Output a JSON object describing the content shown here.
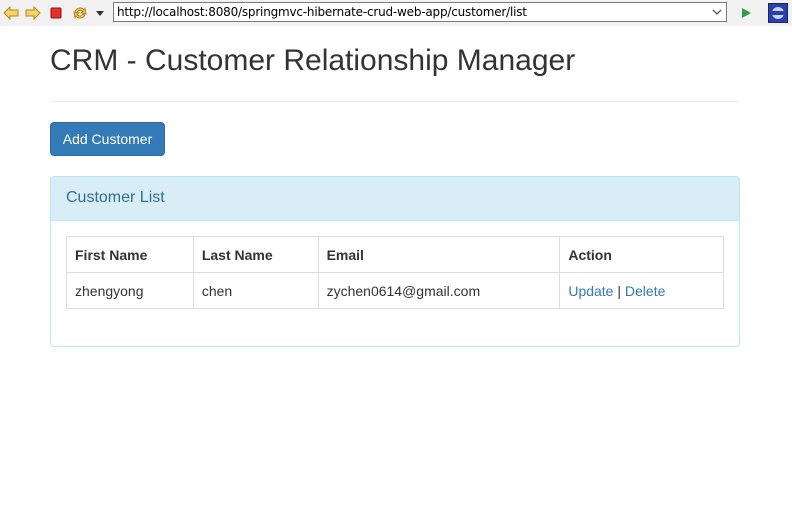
{
  "browser": {
    "url": "http://localhost:8080/springmvc-hibernate-crud-web-app/customer/list",
    "buttons": [
      "back-icon",
      "forward-icon",
      "stop-icon",
      "refresh-icon",
      "menu-dropdown-icon",
      "go-icon",
      "browser-logo-icon"
    ]
  },
  "page": {
    "title": "CRM - Customer Relationship Manager",
    "add_button_label": "Add Customer"
  },
  "panel": {
    "title": "Customer List",
    "columns": [
      "First Name",
      "Last Name",
      "Email",
      "Action"
    ],
    "rows": [
      {
        "first_name": "zhengyong",
        "last_name": "chen",
        "email": "zychen0614@gmail.com",
        "update_label": "Update",
        "separator": "|",
        "delete_label": "Delete"
      }
    ]
  },
  "colors": {
    "primary_button": "#337ab7",
    "panel_heading_bg": "#d9edf7",
    "panel_border": "#bce8f1",
    "panel_title": "#31708f",
    "link": "#337ab7"
  }
}
